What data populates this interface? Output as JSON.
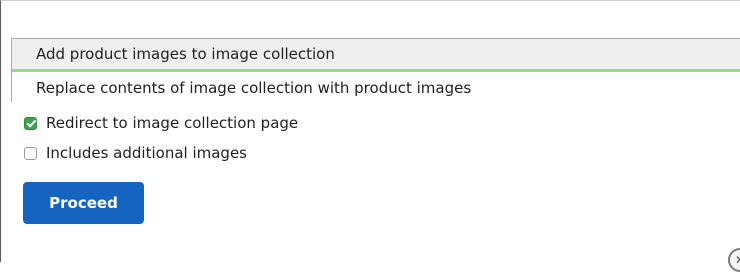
{
  "collection_action": {
    "selected_option": "Add product images to image collection",
    "other_option": "Replace contents of image collection with product images",
    "selected_accent_color": "#9bd88a"
  },
  "options": {
    "redirect": {
      "label": "Redirect to image collection page",
      "checked": true
    },
    "additional": {
      "label": "Includes additional images",
      "checked": false
    }
  },
  "proceed_button": {
    "label": "Proceed",
    "color": "#1565c0"
  },
  "close": {
    "icon": "close-icon",
    "glyph": "✕"
  }
}
